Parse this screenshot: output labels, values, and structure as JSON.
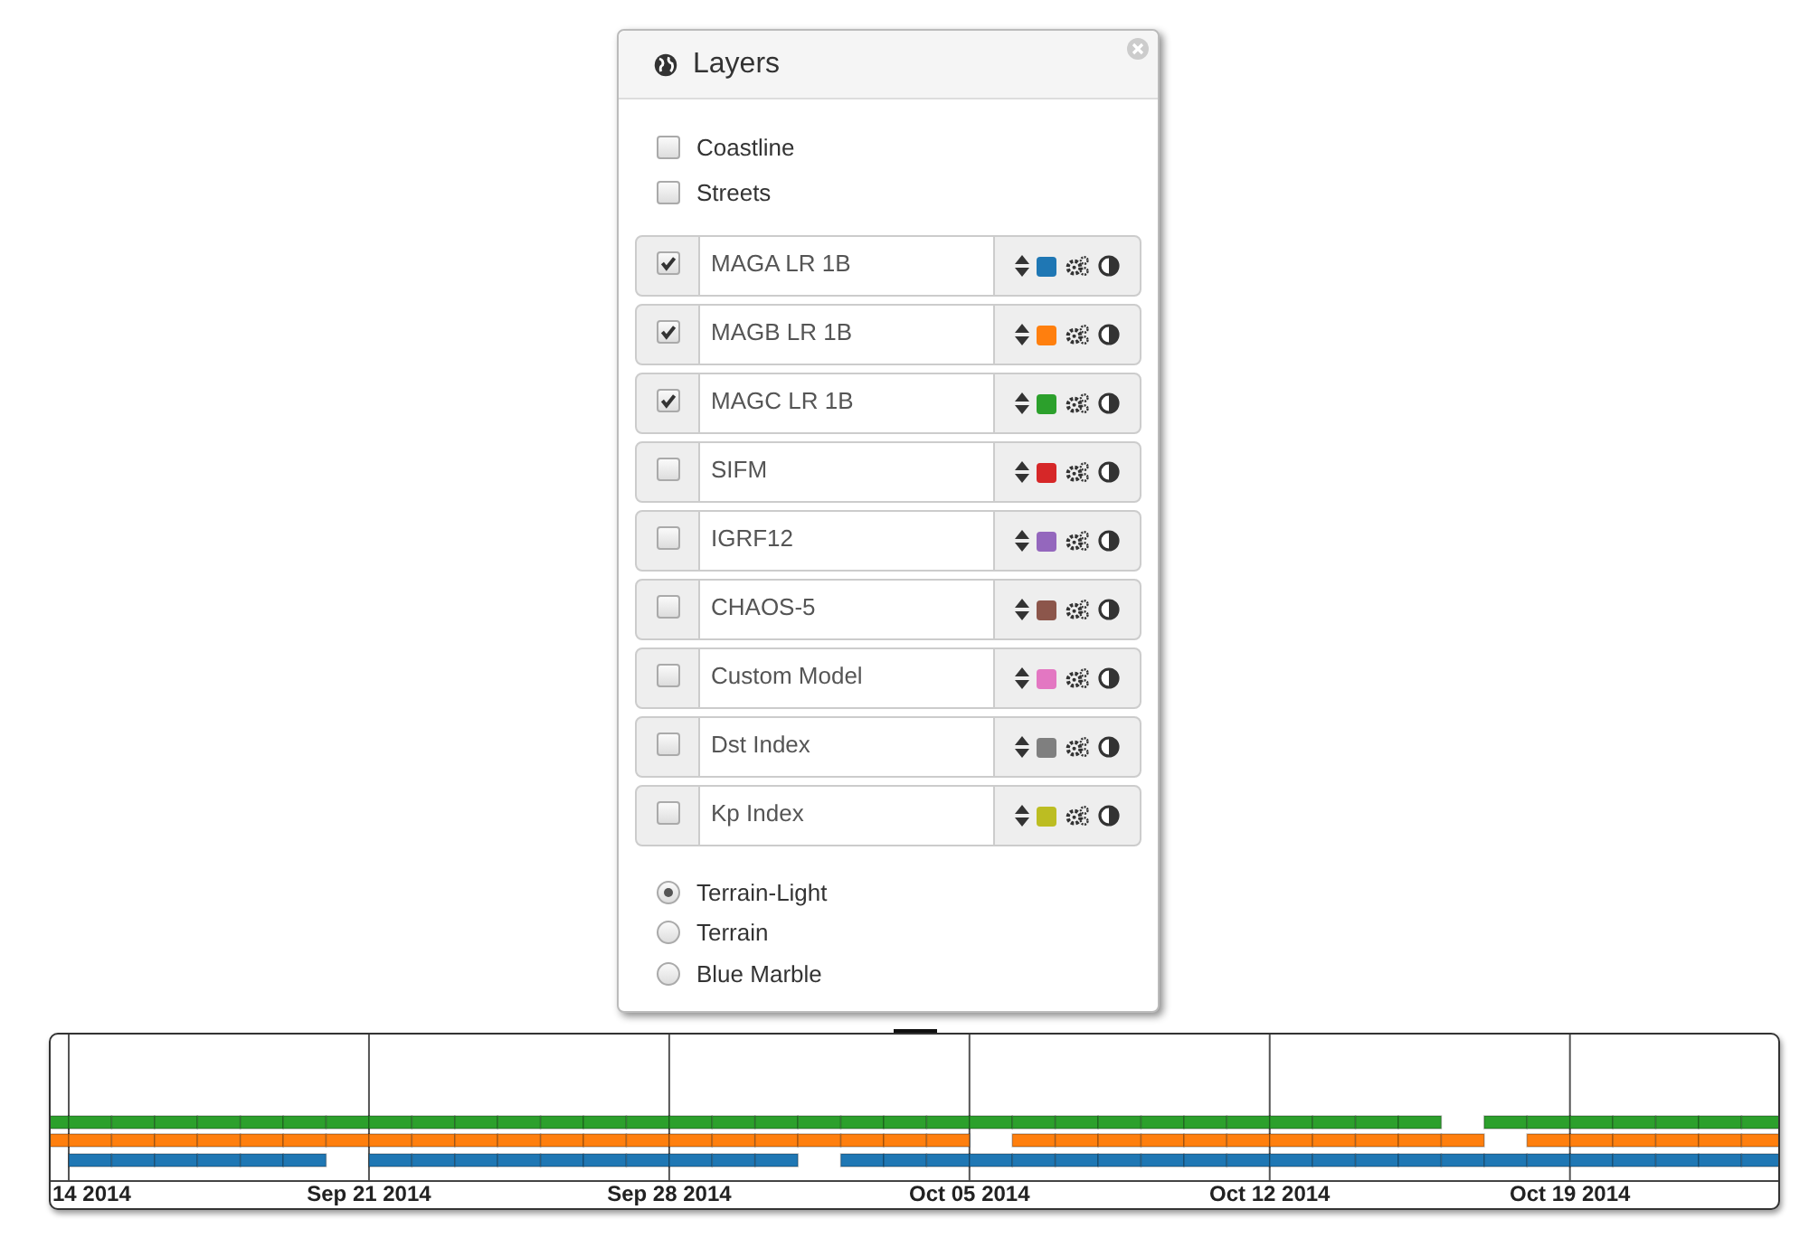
{
  "panel": {
    "title": "Layers",
    "overlays": [
      {
        "label": "Coastline",
        "checked": false
      },
      {
        "label": "Streets",
        "checked": false
      }
    ],
    "layers": [
      {
        "name": "MAGA LR 1B",
        "checked": true,
        "color": "#1f77b4"
      },
      {
        "name": "MAGB LR 1B",
        "checked": true,
        "color": "#ff7f0e"
      },
      {
        "name": "MAGC LR 1B",
        "checked": true,
        "color": "#2ca02c"
      },
      {
        "name": "SIFM",
        "checked": false,
        "color": "#d62728"
      },
      {
        "name": "IGRF12",
        "checked": false,
        "color": "#9467bd"
      },
      {
        "name": "CHAOS-5",
        "checked": false,
        "color": "#8c564b"
      },
      {
        "name": "Custom Model",
        "checked": false,
        "color": "#e377c2"
      },
      {
        "name": "Dst Index",
        "checked": false,
        "color": "#7f7f7f"
      },
      {
        "name": "Kp Index",
        "checked": false,
        "color": "#bcbd22"
      }
    ],
    "base_maps": [
      {
        "label": "Terrain-Light",
        "selected": true
      },
      {
        "label": "Terrain",
        "selected": false
      },
      {
        "label": "Blue Marble",
        "selected": false
      }
    ]
  },
  "timeline": {
    "tick_labels": [
      "14 2014",
      "Sep 21 2014",
      "Sep 28 2014",
      "Oct 05 2014",
      "Oct 12 2014",
      "Oct 19 2014"
    ]
  }
}
